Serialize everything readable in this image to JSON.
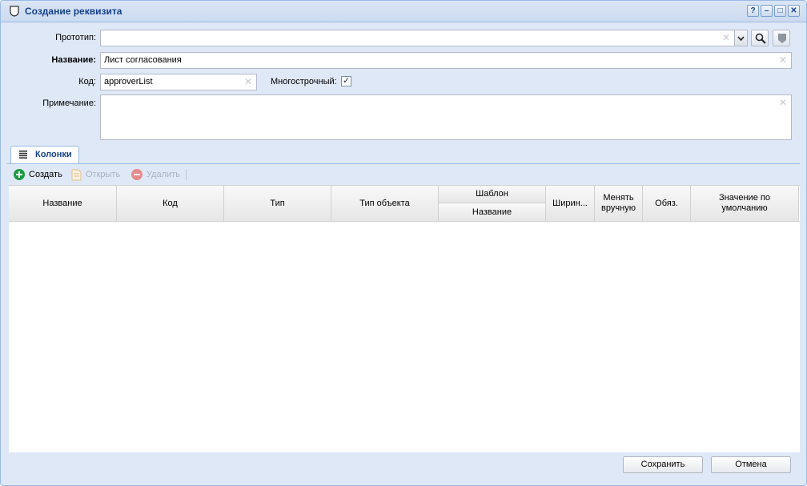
{
  "window": {
    "title": "Создание реквизита",
    "icon": "shield-icon",
    "controls": [
      {
        "name": "help-button",
        "glyph": "?"
      },
      {
        "name": "minimize-button",
        "glyph": "–"
      },
      {
        "name": "maximize-button",
        "glyph": "□"
      },
      {
        "name": "close-button",
        "glyph": "✕"
      }
    ]
  },
  "form": {
    "prototype": {
      "label": "Прототип:",
      "value": ""
    },
    "name": {
      "label": "Название:",
      "value": "Лист согласования"
    },
    "code": {
      "label": "Код:",
      "value": "approverList"
    },
    "multiline": {
      "label": "Многострочный:",
      "checked": true,
      "check_glyph": "✓"
    },
    "note": {
      "label": "Примечание:",
      "value": ""
    },
    "clear_glyph": "✕"
  },
  "tabs": [
    {
      "label": "Колонки",
      "icon": "list-icon",
      "active": true
    }
  ],
  "toolbar": {
    "create_label": "Создать",
    "open_label": "Открыть",
    "delete_label": "Удалить"
  },
  "grid": {
    "columns": {
      "name": "Название",
      "code": "Код",
      "type": "Тип",
      "object_type": "Тип объекта",
      "template_group": "Шаблон",
      "template_name": "Название",
      "width": "Ширин...",
      "manual": "Менять вручную",
      "required": "Обяз.",
      "default": "Значение по умолчанию"
    },
    "rows": []
  },
  "footer": {
    "save_label": "Сохранить",
    "cancel_label": "Отмена"
  },
  "colors": {
    "title_text": "#15428b",
    "window_bg": "#dfe8f6",
    "border": "#99bbe8",
    "create_icon": "#1d9b3f",
    "delete_icon": "#e68a8a"
  }
}
